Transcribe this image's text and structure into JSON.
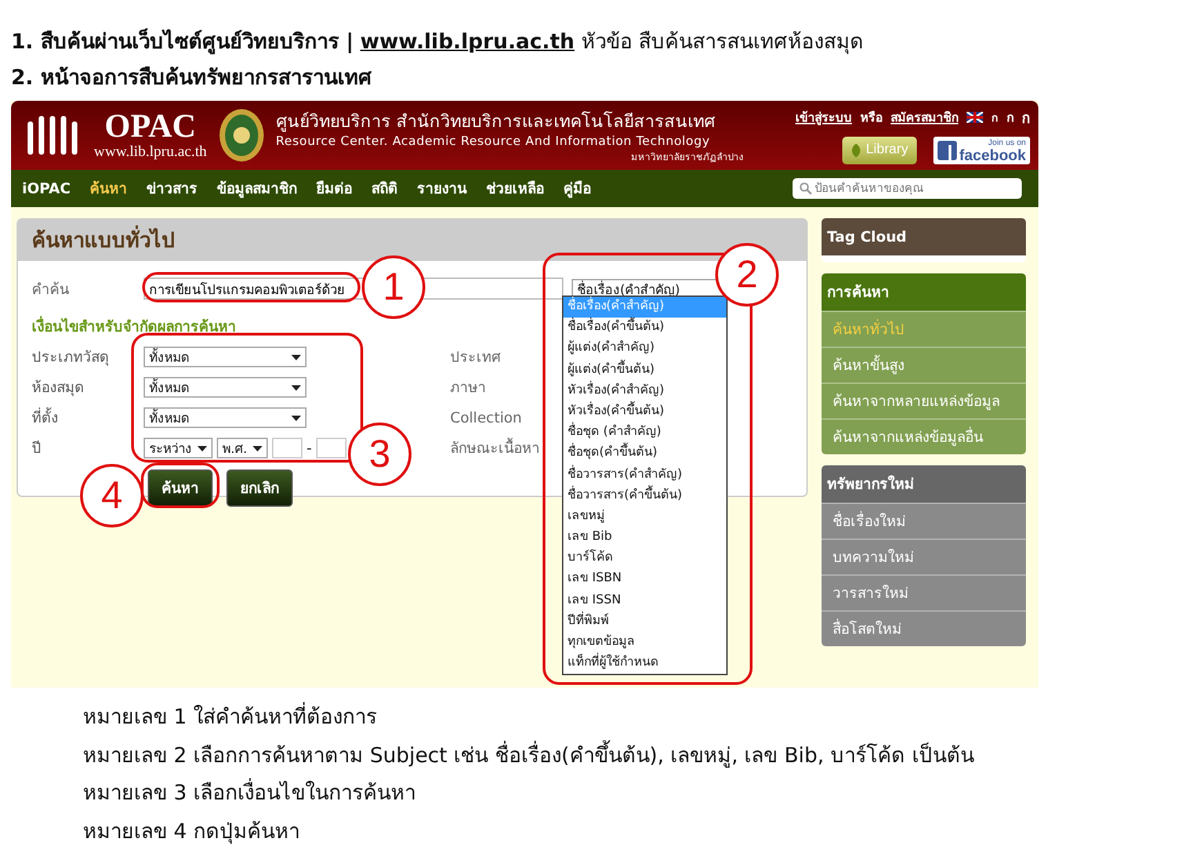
{
  "intro": [
    {
      "kind": "link_line",
      "before": "1. สืบค้นผ่านเว็บไซต์ศูนย์วิทยบริการ |",
      "link": "www.lib.lpru.ac.th",
      "after": "หัวข้อ สืบค้นสารสนเทศห้องสมุด"
    },
    {
      "kind": "plain",
      "before": "2. หน้าจอการสืบค้นทรัพยากรสารานเทศ"
    }
  ],
  "screenshot": {
    "header": {
      "logo_text": "OPAC",
      "logo_url": "www.lib.lpru.ac.th",
      "title_th": "ศูนย์วิทยบริการ สำนักวิทยบริการและเทคโนโลยีสารสนเทศ",
      "title_en": "Resource Center. Academic Resource And Information Technology",
      "university": "มหาวิทยาลัยราชภัฏลำปาง",
      "login_link": "เข้าสู่ระบบ",
      "or_text": "หรือ",
      "register_link": "สมัครสมาชิก",
      "font_sizes": [
        "ก",
        "ก",
        "ก"
      ],
      "library_button": "Library",
      "facebook_top": "Join us on",
      "facebook_name": "facebook"
    },
    "nav": {
      "items": [
        {
          "label": "iOPAC",
          "selected": false
        },
        {
          "label": "ค้นหา",
          "selected": true
        },
        {
          "label": "ข่าวสาร",
          "selected": false
        },
        {
          "label": "ข้อมูลสมาชิก",
          "selected": false
        },
        {
          "label": "ยืมต่อ",
          "selected": false
        },
        {
          "label": "สถิติ",
          "selected": false
        },
        {
          "label": "รายงาน",
          "selected": false
        },
        {
          "label": "ช่วยเหลือ",
          "selected": false
        },
        {
          "label": "คู่มือ",
          "selected": false
        }
      ],
      "search_placeholder": "ป้อนคำค้นหาของคุณ"
    },
    "panel": {
      "title": "ค้นหาแบบทั่วไป",
      "keyword_label": "คำค้น",
      "keyword_value": "การเขียนโปรแกรมคอมพิวเตอร์ด้วย",
      "field_select": {
        "value": "ชื่อเรื่อง(คำสำคัญ)",
        "options": [
          {
            "label": "ชื่อเรื่อง(คำสำคัญ)",
            "selected": true
          },
          {
            "label": "ชื่อเรื่อง(คำขึ้นต้น)",
            "selected": false
          },
          {
            "label": "ผู้แต่ง(คำสำคัญ)",
            "selected": false
          },
          {
            "label": "ผู้แต่ง(คำขึ้นต้น)",
            "selected": false
          },
          {
            "label": "หัวเรื่อง(คำสำคัญ)",
            "selected": false
          },
          {
            "label": "หัวเรื่อง(คำขึ้นต้น)",
            "selected": false
          },
          {
            "label": "ชื่อชุด (คำสำคัญ)",
            "selected": false
          },
          {
            "label": "ชื่อชุด(คำขึ้นต้น)",
            "selected": false
          },
          {
            "label": "ชื่อวารสาร(คำสำคัญ)",
            "selected": false
          },
          {
            "label": "ชื่อวารสาร(คำขึ้นต้น)",
            "selected": false
          },
          {
            "label": "เลขหมู่",
            "selected": false
          },
          {
            "label": "เลข Bib",
            "selected": false
          },
          {
            "label": "บาร์โค้ด",
            "selected": false
          },
          {
            "label": "เลข ISBN",
            "selected": false
          },
          {
            "label": "เลข ISSN",
            "selected": false
          },
          {
            "label": "ปีที่พิมพ์",
            "selected": false
          },
          {
            "label": "ทุกเขตข้อมูล",
            "selected": false
          },
          {
            "label": "แท็กที่ผู้ใช้กำหนด",
            "selected": false
          }
        ]
      },
      "conditions_title": "เงื่อนไขสำหรับจำกัดผลการค้นหา",
      "conditions": [
        {
          "label": "ประเภทวัสดุ",
          "value": "ทั้งหมด",
          "right_label": "ประเทศ"
        },
        {
          "label": "ห้องสมุด",
          "value": "ทั้งหมด",
          "right_label": "ภาษา"
        },
        {
          "label": "ที่ตั้ง",
          "value": "ทั้งหมด",
          "right_label": "Collection"
        }
      ],
      "year": {
        "label": "ปี",
        "range": "ระหว่าง",
        "era": "พ.ศ.",
        "separator": "-",
        "right_label": "ลักษณะเนื้อหา"
      },
      "buttons": [
        "ค้นหา",
        "ยกเลิก"
      ]
    },
    "sidebar": [
      {
        "kind": "tag",
        "title": "Tag Cloud"
      },
      {
        "kind": "search",
        "title": "การค้นหา",
        "items": [
          {
            "label": "ค้นหาทั่วไป",
            "selected": true
          },
          {
            "label": "ค้นหาขั้นสูง",
            "selected": false
          },
          {
            "label": "ค้นหาจากหลายแหล่งข้อมูล",
            "selected": false
          },
          {
            "label": "ค้นหาจากแหล่งข้อมูลอื่น",
            "selected": false
          }
        ]
      },
      {
        "kind": "new",
        "title": "ทรัพยากรใหม่",
        "items": [
          {
            "label": "ชื่อเรื่องใหม่",
            "selected": false
          },
          {
            "label": "บทความใหม่",
            "selected": false
          },
          {
            "label": "วารสารใหม่",
            "selected": false
          },
          {
            "label": "สื่อโสตใหม่",
            "selected": false
          }
        ]
      }
    ],
    "callouts": [
      "1",
      "2",
      "3",
      "4"
    ]
  },
  "notes": [
    "หมายเลข 1 ใส่คำค้นหาที่ต้องการ",
    "หมายเลข 2 เลือกการค้นหาตาม Subject เช่น ชื่อเรื่อง(คำขึ้นต้น), เลขหมู่, เลข Bib, บาร์โค้ด เป็นต้น",
    "หมายเลข 3 เลือกเงื่อนไขในการค้นหา",
    "หมายเลข 4 กดปุ่มค้นหา"
  ]
}
